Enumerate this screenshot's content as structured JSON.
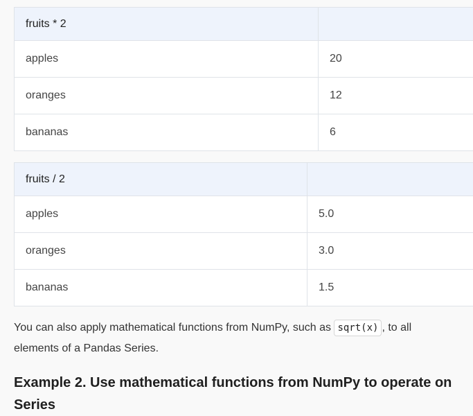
{
  "table1": {
    "header": [
      "fruits * 2",
      ""
    ],
    "rows": [
      [
        "apples",
        "20"
      ],
      [
        "oranges",
        "12"
      ],
      [
        "bananas",
        "6"
      ]
    ]
  },
  "table2": {
    "header": [
      "fruits / 2",
      ""
    ],
    "rows": [
      [
        "apples",
        "5.0"
      ],
      [
        "oranges",
        "3.0"
      ],
      [
        "bananas",
        "1.5"
      ]
    ]
  },
  "paragraph": {
    "before": "You can also apply mathematical functions from NumPy, such as ",
    "code": "sqrt(x)",
    "after": ", to all elements of a Pandas Series."
  },
  "heading": "Example 2. Use mathematical functions from NumPy to operate on Series"
}
